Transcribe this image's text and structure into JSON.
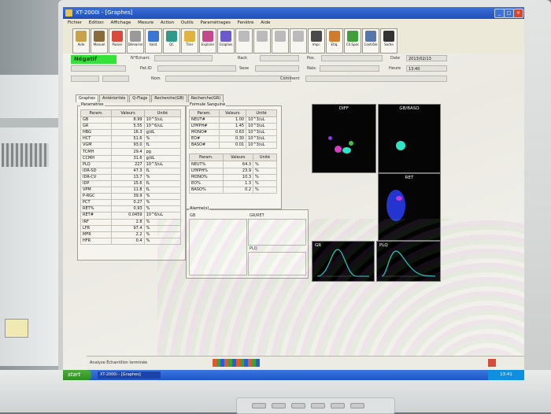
{
  "window": {
    "title": "XT-2000i - [Graphes]"
  },
  "menu": [
    "Fichier",
    "Edition",
    "Affichage",
    "Mesure",
    "Action",
    "Outils",
    "Paramétrages",
    "Fenêtre",
    "Aide"
  ],
  "status": {
    "label": "Négatif"
  },
  "patient": {
    "n_echant_label": "N°Echant.",
    "n_echant": "",
    "rack_label": "Rack",
    "rack": "",
    "date_label": "Date",
    "date": "2013/02/13",
    "pat_id_label": "Pat.ID",
    "pat_id": "",
    "sexe_label": "Sexe",
    "sexe": "",
    "nais_label": "Nais.",
    "nais": "",
    "heure_label": "Heure",
    "heure": "13:40",
    "nom_label": "Nom",
    "nom": "",
    "comment_label": "Comment",
    "comment": ""
  },
  "tabs": [
    "Graphes",
    "Antériorités",
    "Q-Flags",
    "Recherche(GB)",
    "Recherche(GR)"
  ],
  "params_panel": {
    "title": "Paramètres",
    "headers": [
      "Param.",
      "Valeurs",
      "Unité"
    ],
    "rows": [
      [
        "GB",
        "8.99",
        "10^3/uL"
      ],
      [
        "GR",
        "5.55",
        "10^6/uL"
      ],
      [
        "HBG",
        "16.3",
        "g/dL"
      ],
      [
        "HCT",
        "51.6",
        "%"
      ],
      [
        "VGM",
        "93.0",
        "fL"
      ],
      [
        "TCMH",
        "29.4",
        "pg"
      ],
      [
        "CCMH",
        "31.6",
        "g/dL"
      ],
      [
        "PLQ",
        "227",
        "10^3/uL"
      ],
      [
        "IDR-SD",
        "47.3",
        "fL"
      ],
      [
        "IDR-CV",
        "13.7",
        "%"
      ],
      [
        "IDP",
        "15.6",
        "fL"
      ],
      [
        "VPM",
        "11.8",
        "fL"
      ],
      [
        "P-RGC",
        "39.9",
        "%"
      ],
      [
        "PCT",
        "0.27",
        "%"
      ],
      [
        "RET%",
        "0.93",
        "%"
      ],
      [
        "RET#",
        "0.0459",
        "10^6/uL"
      ],
      [
        "IRF",
        "2.8",
        "%"
      ],
      [
        "LFR",
        "97.4",
        "%"
      ],
      [
        "MFR",
        "2.2",
        "%"
      ],
      [
        "HFR",
        "0.4",
        "%"
      ]
    ]
  },
  "formula_panel": {
    "title": "Formule Sanguine",
    "headers": [
      "Param.",
      "Valeurs",
      "Unité"
    ],
    "rows": [
      [
        "NEUT#",
        "1.00",
        "10^3/uL"
      ],
      [
        "LYMPH#",
        "1.45",
        "10^3/uL"
      ],
      [
        "MONO#",
        "0.63",
        "10^3/uL"
      ],
      [
        "EO#",
        "0.30",
        "10^3/uL"
      ],
      [
        "BASO#",
        "0.01",
        "10^3/uL"
      ]
    ],
    "headers2": [
      "Param.",
      "Valeurs",
      "Unité"
    ],
    "rows2": [
      [
        "NEUT%",
        "64.3",
        "%"
      ],
      [
        "LYMPH%",
        "23.9",
        "%"
      ],
      [
        "MONO%",
        "10.3",
        "%"
      ],
      [
        "EO%",
        "1.3",
        "%"
      ],
      [
        "BASO%",
        "0.2",
        "%"
      ]
    ]
  },
  "alarms_panel": {
    "title": "Alarme(s)",
    "gb": "GB",
    "gr_ret": "GR/RET",
    "plq": "PLQ"
  },
  "graphs": {
    "diff": "DIFF",
    "gb_baso": "GB/BASO",
    "ret": "RET",
    "gr": "GR",
    "plq": "PLQ",
    "diff_color": "#2de6c8",
    "ret_color": "#3a4cff",
    "curve_color": "#1fd2c4"
  },
  "statusbar": {
    "text": "Analyse Échantillon terminée"
  },
  "taskbar": {
    "start": "start",
    "item": "XT-2000i - [Graphes]",
    "clock": "13:41"
  },
  "toolbar": [
    {
      "label": "Aide",
      "icon": "person-icon"
    },
    {
      "label": "Manuel",
      "icon": "tools-icon"
    },
    {
      "label": "Passer",
      "icon": "calendar-icon"
    },
    {
      "label": "Démarrer",
      "icon": "blank-icon"
    },
    {
      "label": "Valid.",
      "icon": "check-icon"
    },
    {
      "label": "QC",
      "icon": "qc-icon"
    },
    {
      "label": "Trier",
      "icon": "sort-icon"
    },
    {
      "label": "Explorer",
      "icon": "explore-icon"
    },
    {
      "label": "Graphes",
      "icon": "graph-icon"
    },
    {
      "label": "",
      "icon": "blank-icon"
    },
    {
      "label": "",
      "icon": "blank-icon"
    },
    {
      "label": "",
      "icon": "blank-icon"
    },
    {
      "label": "",
      "icon": "blank-icon"
    },
    {
      "label": "Impr.",
      "icon": "print-icon"
    },
    {
      "label": "Etiq.",
      "icon": "label-icon"
    },
    {
      "label": "Ch.Spec",
      "icon": "chart-icon"
    },
    {
      "label": "Contrôle",
      "icon": "control-icon"
    },
    {
      "label": "Sortie",
      "icon": "exit-icon"
    }
  ]
}
